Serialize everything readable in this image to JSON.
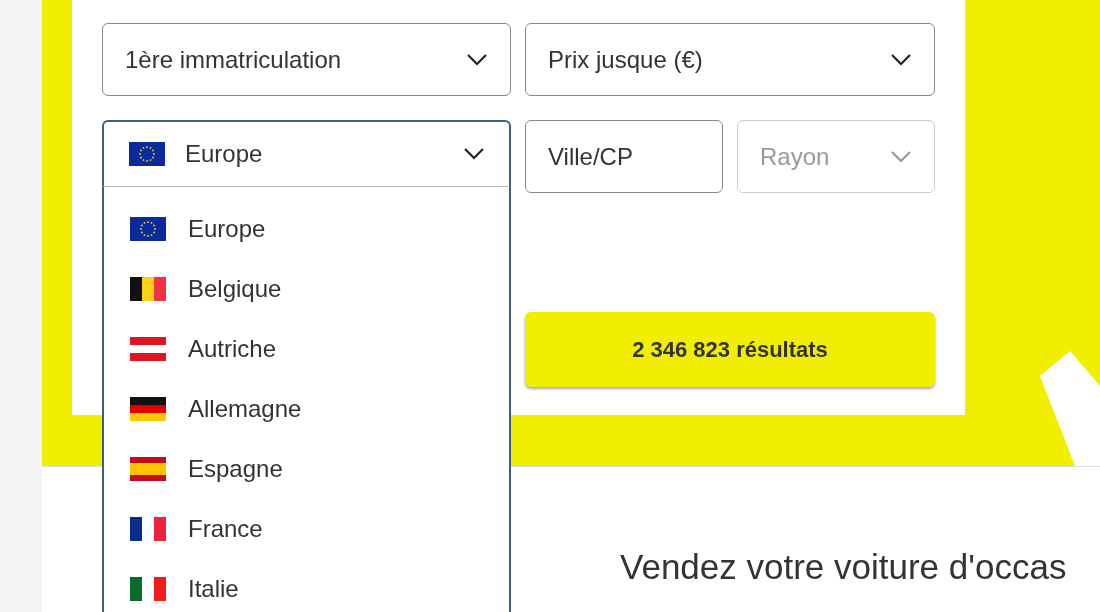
{
  "search_form": {
    "fields": [
      {
        "kind": "select",
        "label": "1ère immatriculation",
        "disabled": false
      },
      {
        "kind": "select",
        "label": "Prix jusque (€)",
        "disabled": false
      },
      {
        "kind": "country",
        "value": {
          "label": "Europe",
          "kind": "eu"
        },
        "expanded": true,
        "options": [
          {
            "label": "Europe",
            "kind": "eu"
          },
          {
            "label": "Belgique",
            "kind": "be"
          },
          {
            "label": "Autriche",
            "kind": "at"
          },
          {
            "label": "Allemagne",
            "kind": "de"
          },
          {
            "label": "Espagne",
            "kind": "es"
          },
          {
            "label": "France",
            "kind": "fr"
          },
          {
            "label": "Italie",
            "kind": "it"
          }
        ]
      },
      {
        "kind": "input",
        "placeholder": "Ville/CP"
      },
      {
        "kind": "select",
        "label": "Rayon",
        "disabled": true
      }
    ],
    "results_button": "2 346 823 résultats"
  },
  "sell_section": {
    "heading": "Vendez votre voiture d'occas"
  }
}
